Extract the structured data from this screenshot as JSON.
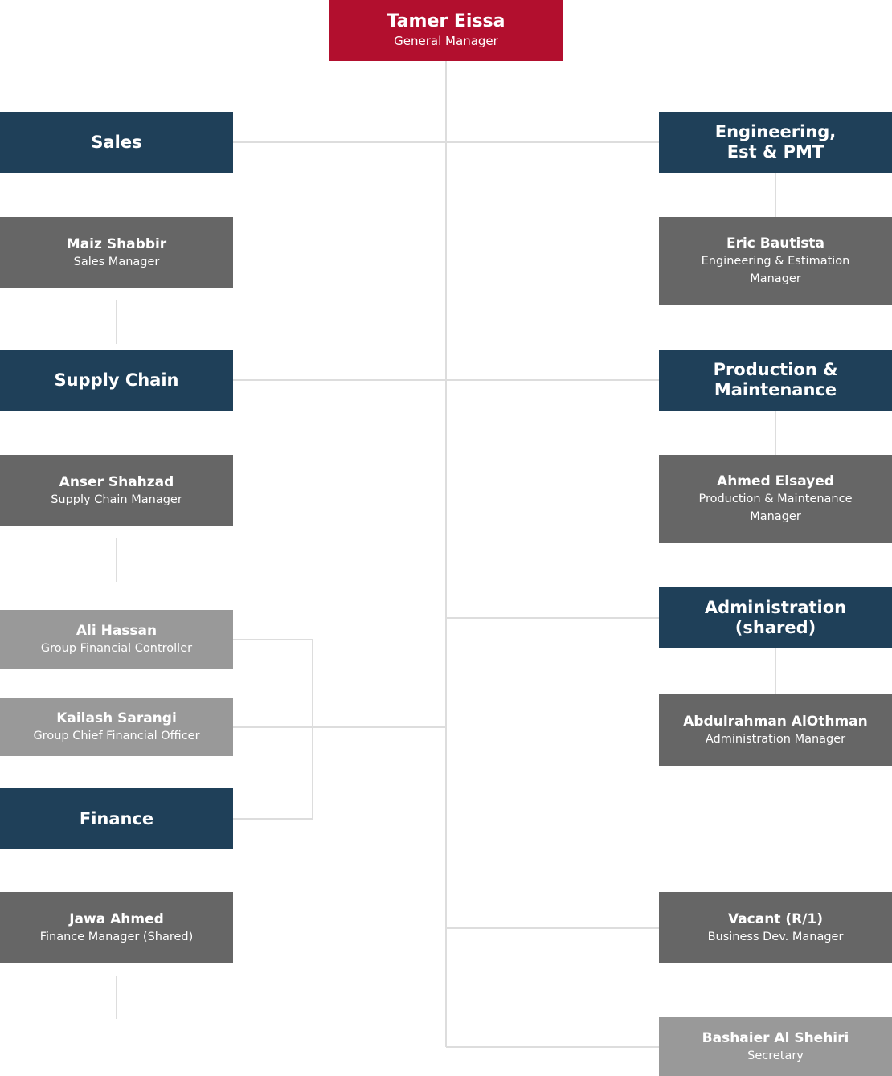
{
  "colors": {
    "general_manager": "#b20f2e",
    "department": "#1f4059",
    "manager": "#666666",
    "secondary": "#999999",
    "connector": "#dddddd"
  },
  "general_manager": {
    "name": "Tamer Eissa",
    "role": "General Manager"
  },
  "left": {
    "sales": "Sales",
    "sales_manager": {
      "name": "Maiz Shabbir",
      "role": "Sales Manager"
    },
    "supply_chain": "Supply Chain",
    "supply_chain_manager": {
      "name": "Anser Shahzad",
      "role": "Supply Chain Manager"
    },
    "financial_controller": {
      "name": "Ali Hassan",
      "role": "Group Financial Controller"
    },
    "cfo": {
      "name": "Kailash Sarangi",
      "role": "Group Chief Financial Officer"
    },
    "finance": "Finance",
    "finance_manager": {
      "name": "Jawa Ahmed",
      "role": "Finance Manager (Shared)"
    }
  },
  "right": {
    "engineering": "Engineering, Est & PMT",
    "engineering_manager": {
      "name": "Eric Bautista",
      "role": "Engineering & Estimation Manager"
    },
    "production": "Production & Maintenance",
    "production_manager": {
      "name": "Ahmed Elsayed",
      "role": "Production & Maintenance Manager"
    },
    "administration": "Administration (shared)",
    "administration_manager": {
      "name": "Abdulrahman AlOthman",
      "role": "Administration Manager"
    },
    "business_dev": {
      "name": "Vacant (R/1)",
      "role": "Business Dev. Manager"
    },
    "secretary": {
      "name": "Bashaier Al Shehiri",
      "role": "Secretary"
    }
  }
}
